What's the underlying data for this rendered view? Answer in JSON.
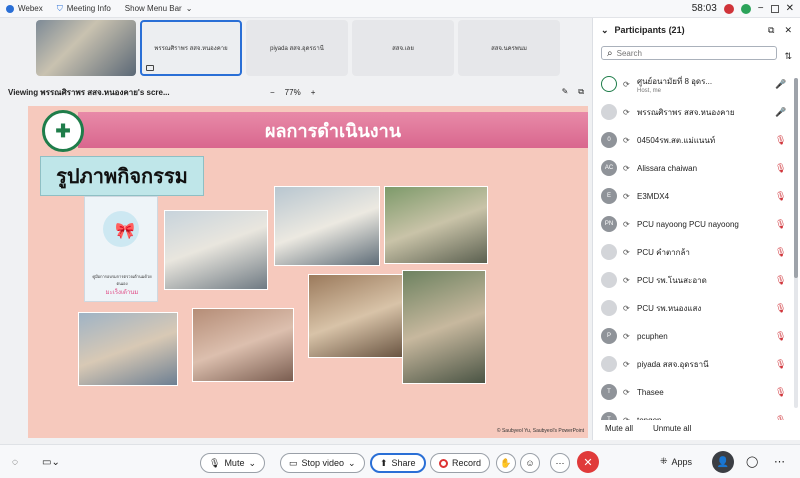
{
  "topbar": {
    "app_name": "Webex",
    "meeting_info": "Meeting Info",
    "show_menu": "Show Menu Bar",
    "timer": "58:03",
    "badge_color": "#d0343a"
  },
  "strip": {
    "tiles": [
      {
        "label": ""
      },
      {
        "label": "พรรณศิราพร สสจ.หนองคาย"
      },
      {
        "label": "piyada สสจ.อุดรธานี"
      },
      {
        "label": "สสจ.เลย"
      },
      {
        "label": "สสจ.นครพนม"
      }
    ]
  },
  "viewbar": {
    "viewing": "Viewing พรรณศิราพร สสจ.หนองคาย's scre...",
    "zoom": "77%",
    "zoom_minus": "−",
    "zoom_plus": "+"
  },
  "slide": {
    "title": "ผลการดำเนินงาน",
    "subtitle": "รูปภาพกิจกรรม",
    "credit": "© Saubyeol Yu, Saubyeol's PowerPoint",
    "book_title": "คู่มือการอบรมการตรวจเต้านมด้วยตนเอง",
    "book_pink": "มะเร็งเต้านม"
  },
  "panel": {
    "title": "Participants (21)",
    "search_placeholder": "Search",
    "participants": [
      {
        "initials": "",
        "name": "ศูนย์อนามัยที่ 8 อุดร...",
        "sub": "Host, me",
        "mic": "on",
        "style": "logo"
      },
      {
        "initials": "",
        "name": "พรรณศิราพร สสจ.หนองคาย",
        "sub": "",
        "mic": "on",
        "style": "light"
      },
      {
        "initials": "0",
        "name": "04504รพ.สต.แม่แนนท์",
        "sub": "",
        "mic": "off",
        "style": "grey"
      },
      {
        "initials": "AC",
        "name": "Alissara chaiwan",
        "sub": "",
        "mic": "off",
        "style": "grey"
      },
      {
        "initials": "E",
        "name": "E3MDX4",
        "sub": "",
        "mic": "off",
        "style": "grey"
      },
      {
        "initials": "PN",
        "name": "PCU nayoong PCU nayoong",
        "sub": "",
        "mic": "off",
        "style": "grey"
      },
      {
        "initials": "",
        "name": "PCU คำตากล้า",
        "sub": "",
        "mic": "off",
        "style": "light"
      },
      {
        "initials": "",
        "name": "PCU รพ.โนนสะอาด",
        "sub": "",
        "mic": "off",
        "style": "light"
      },
      {
        "initials": "",
        "name": "PCU รพ.หนองแสง",
        "sub": "",
        "mic": "off",
        "style": "light"
      },
      {
        "initials": "P",
        "name": "pcuphen",
        "sub": "",
        "mic": "off",
        "style": "grey"
      },
      {
        "initials": "",
        "name": "piyada สสจ.อุดรธานี",
        "sub": "",
        "mic": "off",
        "style": "light"
      },
      {
        "initials": "T",
        "name": "Thasee",
        "sub": "",
        "mic": "off",
        "style": "grey"
      },
      {
        "initials": "T",
        "name": "tongon",
        "sub": "",
        "mic": "off",
        "style": "grey"
      }
    ],
    "mute_all": "Mute all",
    "unmute_all": "Unmute all"
  },
  "bottombar": {
    "mute": "Mute",
    "stop_video": "Stop video",
    "share": "Share",
    "record": "Record",
    "apps": "Apps"
  }
}
